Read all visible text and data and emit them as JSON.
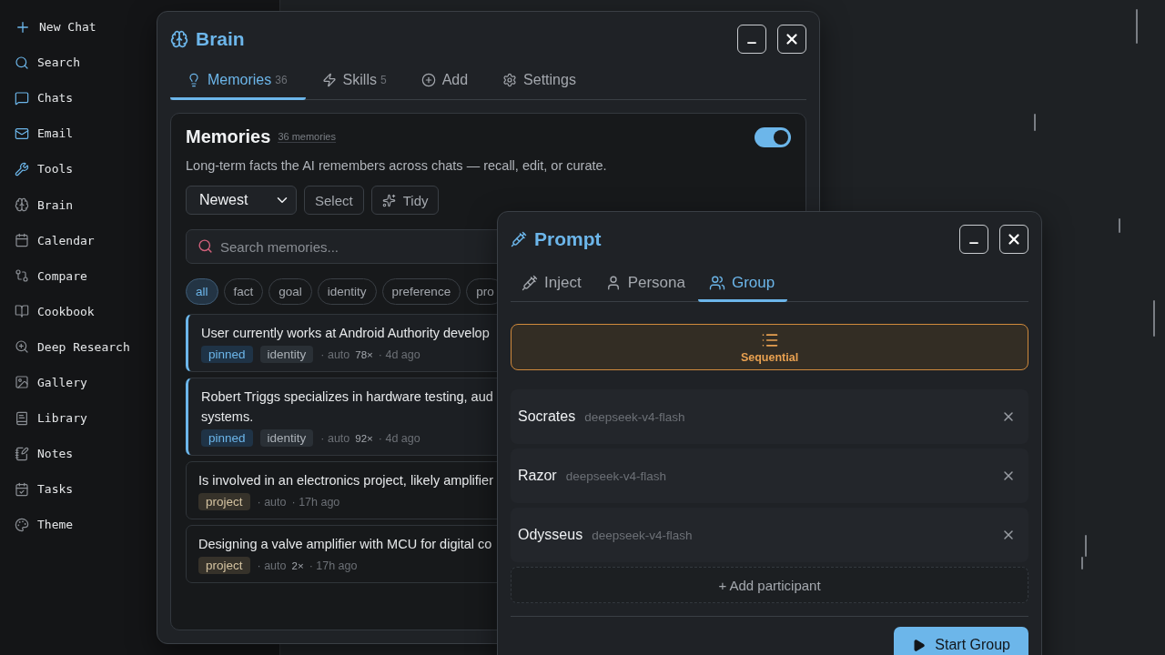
{
  "sidebar": {
    "items": [
      {
        "label": "New Chat",
        "highlighted": true
      },
      {
        "label": "Search",
        "highlighted": true
      },
      {
        "label": "Chats",
        "highlighted": true
      },
      {
        "label": "Email",
        "highlighted": true
      },
      {
        "label": "Tools",
        "highlighted": true
      },
      {
        "label": "Brain",
        "highlighted": false
      },
      {
        "label": "Calendar",
        "highlighted": false
      },
      {
        "label": "Compare",
        "highlighted": false
      },
      {
        "label": "Cookbook",
        "highlighted": false
      },
      {
        "label": "Deep Research",
        "highlighted": false
      },
      {
        "label": "Gallery",
        "highlighted": false
      },
      {
        "label": "Library",
        "highlighted": false
      },
      {
        "label": "Notes",
        "highlighted": false
      },
      {
        "label": "Tasks",
        "highlighted": false
      },
      {
        "label": "Theme",
        "highlighted": false
      }
    ]
  },
  "brain_window": {
    "title": "Brain",
    "tabs": [
      {
        "label": "Memories",
        "count": "36",
        "selected": true
      },
      {
        "label": "Skills",
        "count": "5",
        "selected": false
      },
      {
        "label": "Add",
        "selected": false
      },
      {
        "label": "Settings",
        "selected": false
      }
    ],
    "panel": {
      "title": "Memories",
      "count": "36 memories",
      "enabled": true,
      "description": "Long-term facts the AI remembers across chats — recall, edit, or curate.",
      "sort": "Newest",
      "buttons": [
        "Select",
        "Tidy"
      ],
      "search": {
        "placeholder": "Search memories..."
      },
      "filters": [
        {
          "label": "all",
          "selected": true
        },
        {
          "label": "fact",
          "selected": false
        },
        {
          "label": "goal",
          "selected": false
        },
        {
          "label": "identity",
          "selected": false
        },
        {
          "label": "preference",
          "selected": false
        },
        {
          "label": "pro",
          "selected": false
        }
      ],
      "memories": [
        {
          "lines": [
            "User currently works at Android Authority develop"
          ],
          "pinned": true,
          "tags": [
            {
              "label": "pinned",
              "kind": "pinned"
            },
            {
              "label": "identity",
              "kind": "category"
            }
          ],
          "source": "· auto",
          "uses": "78×",
          "age": "· 4d ago"
        },
        {
          "lines": [
            "Robert Triggs specializes in hardware testing, aud",
            "systems."
          ],
          "pinned": true,
          "tags": [
            {
              "label": "pinned",
              "kind": "pinned"
            },
            {
              "label": "identity",
              "kind": "category"
            }
          ],
          "source": "· auto",
          "uses": "92×",
          "age": "· 4d ago"
        },
        {
          "lines": [
            "Is involved in an electronics project, likely amplifier"
          ],
          "pinned": false,
          "tags": [
            {
              "label": "project",
              "kind": "project"
            }
          ],
          "source": "· auto",
          "age": "· 17h ago"
        },
        {
          "lines": [
            "Designing a valve amplifier with MCU for digital co"
          ],
          "pinned": false,
          "tags": [
            {
              "label": "project",
              "kind": "project"
            }
          ],
          "source": "· auto",
          "uses": "2×",
          "age": "· 17h ago"
        }
      ]
    }
  },
  "prompt_window": {
    "title": "Prompt",
    "tabs": [
      {
        "label": "Inject",
        "selected": false
      },
      {
        "label": "Persona",
        "selected": false
      },
      {
        "label": "Group",
        "selected": true
      }
    ],
    "modes": [
      {
        "label": "Sequential",
        "selected": true
      }
    ],
    "participants": [
      {
        "name": "Socrates",
        "model": "deepseek-v4-flash"
      },
      {
        "name": "Razor",
        "model": "deepseek-v4-flash"
      },
      {
        "name": "Odysseus",
        "model": "deepseek-v4-flash"
      }
    ],
    "add_label": "+ Add participant",
    "start_label": "Start Group"
  }
}
